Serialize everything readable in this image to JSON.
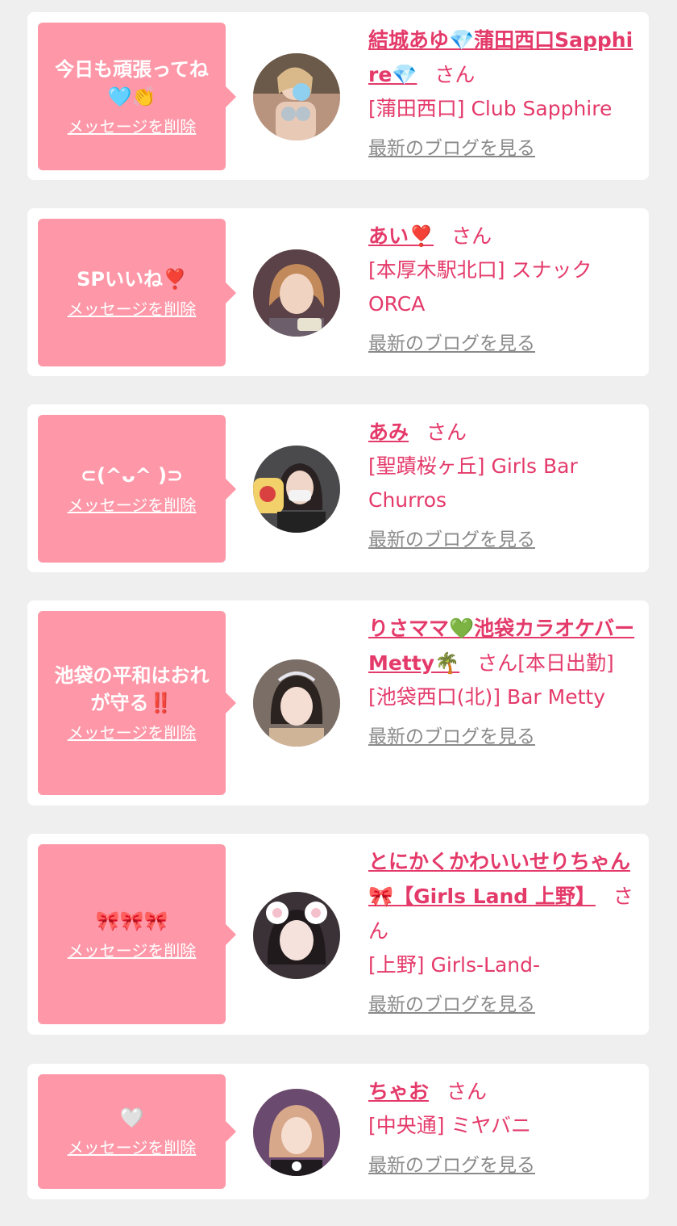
{
  "common": {
    "delete_label": "メッセージを削除",
    "blog_label": "最新のブログを見る"
  },
  "items": [
    {
      "message": "今日も頑張ってね\n🩵👏",
      "name": "結城あゆ💎蒲田西口Sapphire💎",
      "suffix": "さん",
      "status": "",
      "shop": "[蒲田西口] Club Sapphire"
    },
    {
      "message": "SPいいね❣️",
      "name": "あい❣️",
      "suffix": "さん",
      "status": "",
      "shop": "[本厚木駅北口] スナックORCA"
    },
    {
      "message": "⊂(^ᴗ^ )⊃",
      "name": "あみ",
      "suffix": "さん",
      "status": "",
      "shop": "[聖蹟桜ヶ丘] Girls Bar Churros"
    },
    {
      "message": "池袋の平和はおれが守る‼️",
      "name": "りさママ💚池袋カラオケバーMetty🌴",
      "suffix": "さん",
      "status": "[本日出勤]",
      "shop": "[池袋西口(北)] Bar Metty"
    },
    {
      "message": "🎀🎀🎀",
      "name": "とにかくかわいいせりちゃん🎀【Girls Land 上野】",
      "suffix": "さん",
      "status": "",
      "shop": "[上野] Girls-Land-"
    },
    {
      "message": "🤍",
      "name": "ちゃお",
      "suffix": "さん",
      "status": "",
      "shop": "[中央通] ミヤバニ"
    }
  ],
  "colors": {
    "page_bg": "#efefef",
    "card_bg": "#ffffff",
    "bubble_bg": "#fe98a8",
    "name_pink": "#e43a6a",
    "blog_gray": "#8a8a8a"
  }
}
